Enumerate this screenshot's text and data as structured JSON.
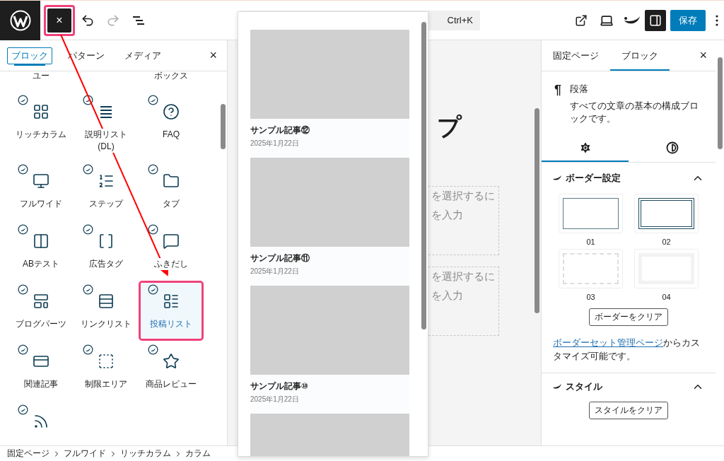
{
  "top_bar": {
    "close_button": {
      "label": "×",
      "highlighted": true
    },
    "redo": {
      "disabled": true
    },
    "search": {
      "shortcut": "Ctrl+K"
    },
    "sidebar_toggle": {
      "on": true
    },
    "save_button": "保存"
  },
  "inserter": {
    "tabs": [
      {
        "label": "ブロック",
        "selected": true
      },
      {
        "label": "パターン",
        "selected": false
      },
      {
        "label": "メディア",
        "selected": false
      }
    ],
    "close": "×",
    "blocks": [
      {
        "kind": "cut",
        "label": "ユー"
      },
      {
        "kind": "blank"
      },
      {
        "kind": "cut",
        "label": "ボックス"
      },
      {
        "kind": "block",
        "label": "リッチカラム",
        "selected": false,
        "highlighted": false
      },
      {
        "kind": "block",
        "label": "説明リスト (DL)",
        "selected": false,
        "highlighted": false
      },
      {
        "kind": "block",
        "label": "FAQ",
        "selected": false,
        "highlighted": false
      },
      {
        "kind": "block",
        "label": "フルワイド",
        "selected": false,
        "highlighted": false
      },
      {
        "kind": "block",
        "label": "ステップ",
        "selected": false,
        "highlighted": false
      },
      {
        "kind": "block",
        "label": "タブ",
        "selected": false,
        "highlighted": false
      },
      {
        "kind": "block",
        "label": "ABテスト",
        "selected": false,
        "highlighted": false
      },
      {
        "kind": "block",
        "label": "広告タグ",
        "selected": false,
        "highlighted": false
      },
      {
        "kind": "block",
        "label": "ふきだし",
        "selected": false,
        "highlighted": false
      },
      {
        "kind": "block",
        "label": "ブログパーツ",
        "selected": false,
        "highlighted": false
      },
      {
        "kind": "block",
        "label": "リンクリスト",
        "selected": false,
        "highlighted": false
      },
      {
        "kind": "block",
        "label": "投稿リスト",
        "selected": true,
        "highlighted": true
      },
      {
        "kind": "block",
        "label": "関連記事",
        "selected": false,
        "highlighted": false
      },
      {
        "kind": "block",
        "label": "制限エリア",
        "selected": false,
        "highlighted": false
      },
      {
        "kind": "block",
        "label": "商品レビュー",
        "selected": false,
        "highlighted": false
      },
      {
        "kind": "icon_only",
        "selected": false,
        "highlighted": false
      }
    ]
  },
  "preview": {
    "posts": [
      {
        "kind": "full",
        "title": "サンプル記事⑫",
        "date": "2025年1月22日"
      },
      {
        "kind": "full",
        "title": "サンプル記事⑪",
        "date": "2025年1月22日"
      },
      {
        "kind": "full",
        "title": "サンプル記事⑩",
        "date": "2025年1月22日"
      },
      {
        "kind": "image_only"
      }
    ]
  },
  "canvas": {
    "heading": "プ",
    "placeholders": [
      {
        "line_1": "を選択するに",
        "line_2": "を入力"
      },
      {
        "line_1": "を選択するに",
        "line_2": "を入力"
      }
    ]
  },
  "settings": {
    "tabs": [
      {
        "label": "固定ページ",
        "selected": false
      },
      {
        "label": "ブロック",
        "selected": true
      }
    ],
    "close": "×",
    "block_card": {
      "symbol": "¶",
      "title": "段落",
      "description": "すべての文章の基本の構成ブロックです。"
    },
    "sub_tabs": [
      {
        "kind": "settings",
        "selected": true
      },
      {
        "kind": "styles",
        "selected": false
      }
    ],
    "border_section": {
      "title": "ボーダー設定",
      "expanded": true,
      "options": [
        {
          "kind": "solid",
          "label": "01"
        },
        {
          "kind": "double",
          "label": "02"
        },
        {
          "kind": "dashed",
          "label": "03"
        },
        {
          "kind": "soft",
          "label": "04"
        }
      ],
      "clear_button": "ボーダーをクリア",
      "link": "ボーダーセット管理ページ",
      "note": "からカスタマイズ可能です。"
    },
    "style_section": {
      "title": "スタイル",
      "expanded": true,
      "clear_button": "スタイルをクリア"
    }
  },
  "breadcrumbs": [
    "固定ページ",
    "フルワイド",
    "リッチカラム",
    "カラム"
  ]
}
